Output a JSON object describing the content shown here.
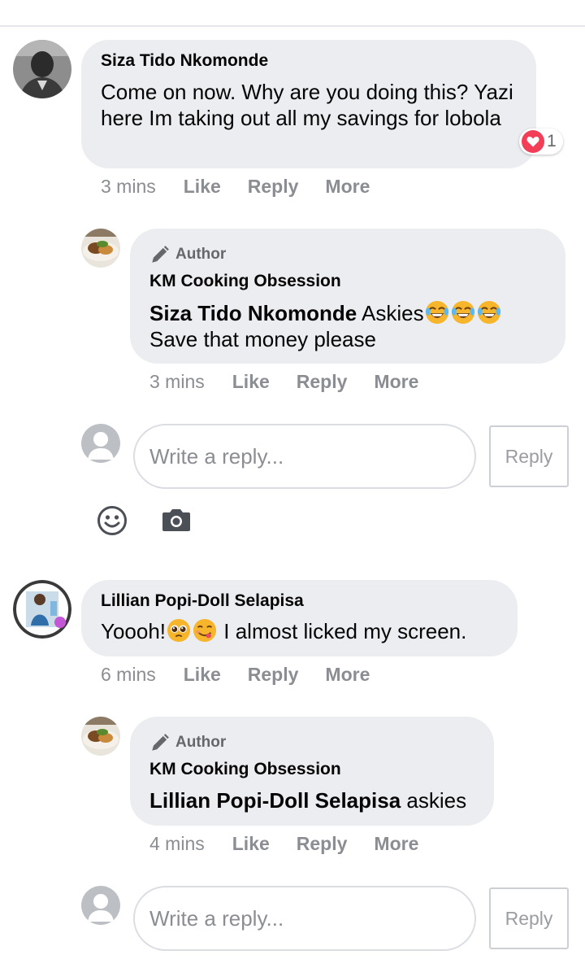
{
  "comments": [
    {
      "author": "Siza Tido Nkomonde",
      "text": "Come on now. Why are you doing this? Yazi here Im taking out all my savings for lobola",
      "reaction_count": "1",
      "time": "3 mins",
      "actions": {
        "like": "Like",
        "reply": "Reply",
        "more": "More"
      },
      "reply": {
        "badge": "Author",
        "author": "KM Cooking Obsession",
        "mention": "Siza Tido Nkomonde",
        "text_line1": "Askies",
        "emojis": [
          "tears-of-joy",
          "tears-of-joy",
          "tears-of-joy"
        ],
        "text_line2": "Save that money please",
        "time": "3 mins",
        "actions": {
          "like": "Like",
          "reply": "Reply",
          "more": "More"
        }
      },
      "reply_box": {
        "placeholder": "Write a reply...",
        "button": "Reply"
      }
    },
    {
      "author": "Lillian Popi-Doll Selapisa",
      "text_before": "Yoooh!",
      "emojis": [
        "pleading-face",
        "face-savoring-food"
      ],
      "text_after": "I almost licked my screen.",
      "time": "6 mins",
      "actions": {
        "like": "Like",
        "reply": "Reply",
        "more": "More"
      },
      "reply": {
        "badge": "Author",
        "author": "KM Cooking Obsession",
        "mention": "Lillian Popi-Doll Selapisa",
        "text": "askies",
        "time": "4 mins",
        "actions": {
          "like": "Like",
          "reply": "Reply",
          "more": "More"
        }
      },
      "reply_box": {
        "placeholder": "Write a reply...",
        "button": "Reply"
      }
    }
  ],
  "composer_icons": [
    "smiley-icon",
    "camera-icon"
  ],
  "colors": {
    "bubble": "#ebedf0",
    "meta": "#8a8d91",
    "heart": "#f33e58",
    "text": "#050505"
  }
}
